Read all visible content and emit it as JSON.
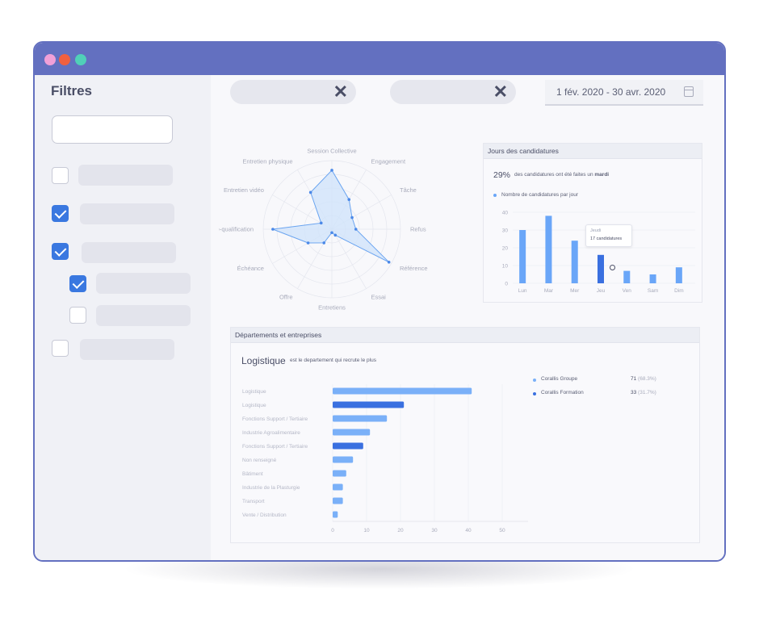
{
  "window": {
    "dots": [
      {
        "name": "pink",
        "color": "#f0a0d8"
      },
      {
        "name": "orange",
        "color": "#f06040"
      },
      {
        "name": "teal",
        "color": "#50d0b8"
      }
    ]
  },
  "sidebar": {
    "title": "Filtres",
    "checkboxes": [
      {
        "checked": false
      },
      {
        "checked": true
      },
      {
        "checked": true
      },
      {
        "checked": true
      },
      {
        "checked": false
      },
      {
        "checked": false
      }
    ]
  },
  "toolbar": {
    "date_range": "1 fév. 2020 - 30 avr. 2020",
    "clear_glyph": "✕"
  },
  "radar_chart": {
    "chart_data": {
      "type": "radar",
      "axes": [
        "Session Collective",
        "Engagement",
        "Tâche",
        "Refus",
        "Référence",
        "Essai",
        "Entretiens",
        "Offre",
        "Échéance",
        "Pré-qualification",
        "Entretien vidéo",
        "Entretien physique"
      ],
      "values": [
        0.86,
        0.5,
        0.34,
        0.35,
        0.96,
        0.1,
        0.05,
        0.23,
        0.4,
        0.86,
        0.18,
        0.62
      ],
      "range": [
        0,
        1
      ],
      "fill_color": "#cfe3fb",
      "line_color": "#6aa4f0"
    }
  },
  "jours_card": {
    "title": "Jours des candidatures",
    "percent": "29%",
    "sentence": "des candidatures ont été faites un",
    "day": "mardi",
    "legend": "Nombre de candidatures par jour",
    "tooltip_day": "Jeudi",
    "tooltip_value": "17 candidatures",
    "chart_data": {
      "type": "bar",
      "categories": [
        "Lun",
        "Mar",
        "Mer",
        "Jeu",
        "Ven",
        "Sam",
        "Dim"
      ],
      "values": [
        30,
        38,
        24,
        16,
        7,
        5,
        9
      ],
      "ylim": [
        0,
        40
      ],
      "yticks": [
        0,
        10,
        20,
        30,
        40
      ],
      "highlight_index": 3,
      "colors": {
        "bar": "#6aa6f8",
        "highlight": "#3a70e0"
      }
    }
  },
  "dept_card": {
    "title": "Départements et entreprises",
    "headline": "Logistique",
    "subtitle": "est le departement qui recrute le plus",
    "legend": [
      {
        "label": "Corallis Groupe",
        "value": "71",
        "pct": "(68.3%)",
        "color": "#7ab0f8"
      },
      {
        "label": "Corallis Formation",
        "value": "33",
        "pct": "(31.7%)",
        "color": "#3a70e0"
      }
    ],
    "chart_data": {
      "type": "bar",
      "orientation": "horizontal",
      "categories": [
        "Logistique",
        "Logistique",
        "Fonctions Support / Tertiaire",
        "Industrie Agroalimentaire",
        "Fonctions Support / Tertiaire",
        "Non renseigné",
        "Bâtiment",
        "Industrie de la Plasturgie",
        "Transport",
        "Vente / Distribution"
      ],
      "values": [
        41,
        21,
        16,
        11,
        9,
        6,
        4,
        3,
        3,
        1.5
      ],
      "series_of_bar": [
        0,
        1,
        0,
        0,
        1,
        0,
        0,
        0,
        0,
        0
      ],
      "xlim": [
        0,
        50
      ],
      "xticks": [
        0,
        10,
        20,
        30,
        40,
        50
      ],
      "colors": {
        "0": "#7ab0f8",
        "1": "#3a70e0"
      }
    }
  }
}
